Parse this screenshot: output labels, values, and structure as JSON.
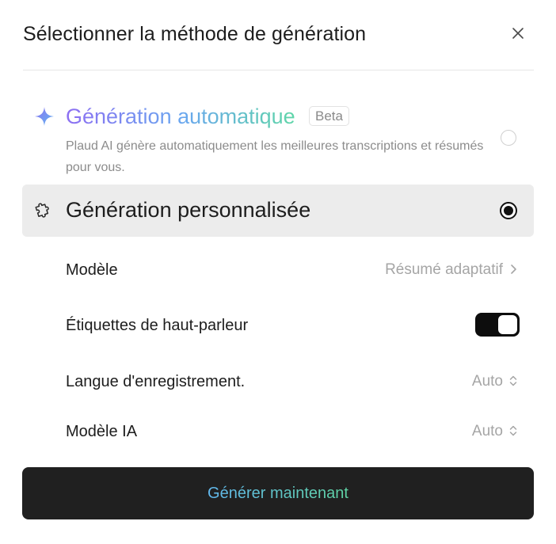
{
  "dialog": {
    "title": "Sélectionner la méthode de génération"
  },
  "auto_option": {
    "title": "Génération automatique",
    "badge": "Beta",
    "description": "Plaud AI génère automatiquement les meilleures transcriptions et résumés pour vous.",
    "selected": false,
    "icon": "sparkle-icon"
  },
  "custom_option": {
    "title": "Génération personnalisée",
    "selected": true,
    "icon": "puzzle-icon"
  },
  "settings": {
    "model": {
      "label": "Modèle",
      "value": "Résumé adaptatif"
    },
    "speaker_labels": {
      "label": "Étiquettes de haut-parleur",
      "enabled": true
    },
    "recording_language": {
      "label": "Langue d'enregistrement.",
      "value": "Auto"
    },
    "ai_model": {
      "label": "Modèle IA",
      "value": "Auto"
    }
  },
  "actions": {
    "generate_label": "Générer maintenant"
  },
  "colors": {
    "primary_button_bg": "#202020",
    "selected_row_bg": "#ececec",
    "gradient_start": "#8d6ff2",
    "gradient_end": "#5fd6a8"
  }
}
